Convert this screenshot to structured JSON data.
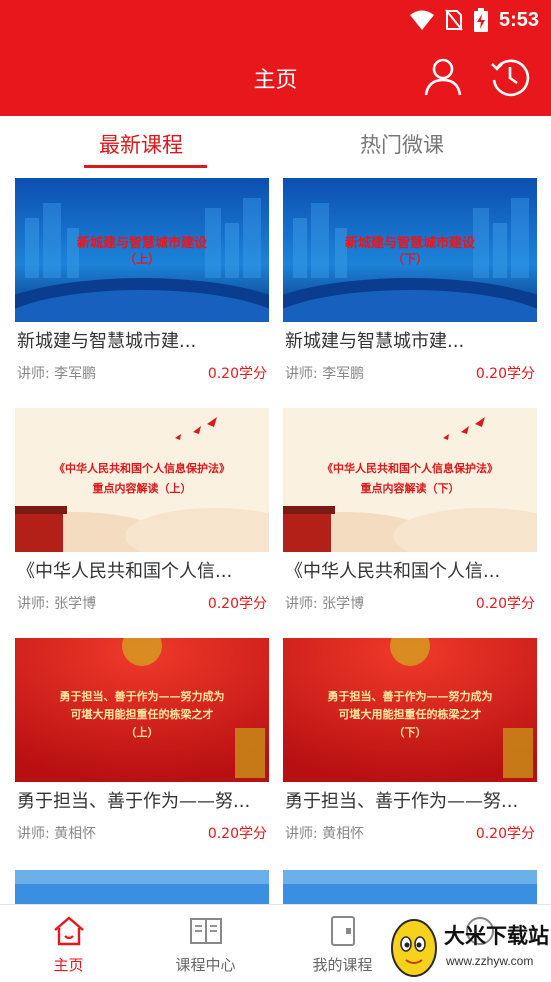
{
  "status": {
    "time": "5:53",
    "icons": [
      "wifi-icon",
      "no-sim-icon",
      "battery-charging-icon"
    ]
  },
  "header": {
    "title": "主页",
    "icons": [
      "user-icon",
      "history-clock-icon"
    ]
  },
  "tabs": [
    {
      "label": "最新课程",
      "active": true
    },
    {
      "label": "热门微课",
      "active": false
    }
  ],
  "courses": [
    {
      "title": "新城建与智慧城市建...",
      "teacher": "讲师:  李军鹏",
      "credit": "0.20学分",
      "thumb_line1": "新城建与智慧城市建设",
      "thumb_line2": "（上）",
      "theme": "blue-city"
    },
    {
      "title": "新城建与智慧城市建...",
      "teacher": "讲师:  李军鹏",
      "credit": "0.20学分",
      "thumb_line1": "新城建与智慧城市建设",
      "thumb_line2": "（下）",
      "theme": "blue-city"
    },
    {
      "title": "《中华人民共和国个人信...",
      "teacher": "讲师:  张学博",
      "credit": "0.20学分",
      "thumb_line1": "《中华人民共和国个人信息保护法》",
      "thumb_line2": "重点内容解读（上）",
      "theme": "cream-cloud"
    },
    {
      "title": "《中华人民共和国个人信...",
      "teacher": "讲师:  张学博",
      "credit": "0.20学分",
      "thumb_line1": "《中华人民共和国个人信息保护法》",
      "thumb_line2": "重点内容解读（下）",
      "theme": "cream-cloud"
    },
    {
      "title": "勇于担当、善于作为——努...",
      "teacher": "讲师:  黄相怀",
      "credit": "0.20学分",
      "thumb_line1": "勇于担当、善于作为——努力成为",
      "thumb_line2": "可堪大用能担重任的栋梁之才",
      "thumb_line3": "（上）",
      "theme": "red-flag"
    },
    {
      "title": "勇于担当、善于作为——努...",
      "teacher": "讲师:  黄相怀",
      "credit": "0.20学分",
      "thumb_line1": "勇于担当、善于作为——努力成为",
      "thumb_line2": "可堪大用能担重任的栋梁之才",
      "thumb_line3": "（下）",
      "theme": "red-flag"
    }
  ],
  "bottom_nav": [
    {
      "label": "主页",
      "icon": "home-icon",
      "active": true
    },
    {
      "label": "课程中心",
      "icon": "book-icon",
      "active": false
    },
    {
      "label": "我的课程",
      "icon": "notebook-icon",
      "active": false
    },
    {
      "label": "",
      "icon": "more-icon",
      "active": false
    }
  ],
  "watermark": {
    "name": "大米下载站",
    "url": "www.zzhyw.com"
  },
  "colors": {
    "primary": "#e8171c",
    "tab_active": "#d9191c",
    "text": "#333333",
    "muted": "#888888"
  }
}
